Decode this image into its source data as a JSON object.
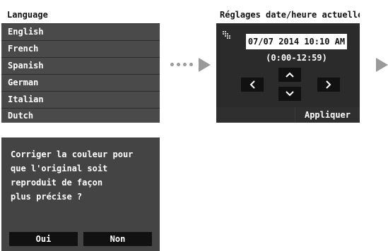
{
  "language_screen": {
    "title": "Language",
    "items": [
      "English",
      "French",
      "Spanish",
      "German",
      "Italian",
      "Dutch"
    ]
  },
  "datetime_screen": {
    "title": "Réglages date/heure actuelle",
    "value": "07/07 2014 10:10 AM",
    "range": "(0:00-12:59)",
    "apply_label": "Appliquer",
    "icons": [
      "settings-icon",
      "chevron-up-icon",
      "chevron-down-icon",
      "chevron-left-icon",
      "chevron-right-icon"
    ]
  },
  "color_screen": {
    "lines": [
      "Corriger la couleur pour",
      "que l'original soit",
      "reproduit de façon",
      "plus précise ?"
    ],
    "yes_label": "Oui",
    "no_label": "Non"
  },
  "colors": {
    "arrow": "#9a9a9a",
    "screen_dark": "#2e2e2e",
    "list_item": "#4a4a4a",
    "button": "#111111"
  }
}
